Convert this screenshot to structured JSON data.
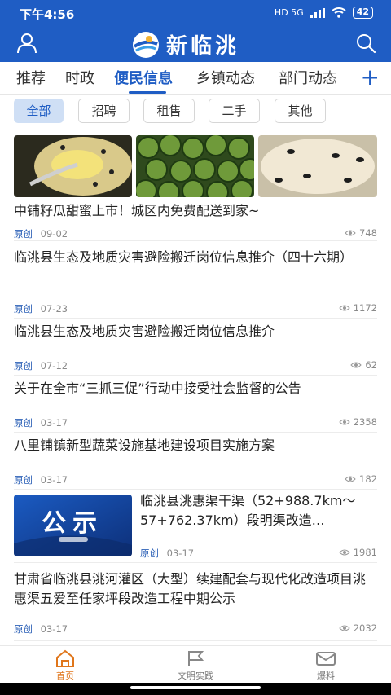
{
  "status_bar": {
    "time": "下午4:56",
    "network": "HD 5G",
    "battery": "42"
  },
  "header": {
    "logo_text": "新临洮"
  },
  "channel_tabs": [
    {
      "label": "推荐",
      "active": false
    },
    {
      "label": "时政",
      "active": false
    },
    {
      "label": "便民信息",
      "active": true
    },
    {
      "label": "乡镇动态",
      "active": false
    },
    {
      "label": "部门动态",
      "active": false
    }
  ],
  "filters": [
    {
      "label": "全部",
      "active": true
    },
    {
      "label": "招聘",
      "active": false
    },
    {
      "label": "租售",
      "active": false
    },
    {
      "label": "二手",
      "active": false
    },
    {
      "label": "其他",
      "active": false
    }
  ],
  "articles": [
    {
      "title": "中铺籽瓜甜蜜上市！城区内免费配送到家~",
      "source": "原创",
      "date": "09-02",
      "views": "748",
      "layout": "three-images"
    },
    {
      "title": "临洮县生态及地质灾害避险搬迁岗位信息推介（四十六期）",
      "source": "原创",
      "date": "07-23",
      "views": "1172",
      "layout": "text"
    },
    {
      "title": "临洮县生态及地质灾害避险搬迁岗位信息推介",
      "source": "原创",
      "date": "07-12",
      "views": "62",
      "layout": "text"
    },
    {
      "title": "关于在全市“三抓三促”行动中接受社会监督的公告",
      "source": "原创",
      "date": "03-17",
      "views": "2358",
      "layout": "text"
    },
    {
      "title": "八里铺镇新型蔬菜设施基地建设项目实施方案",
      "source": "原创",
      "date": "03-17",
      "views": "182",
      "layout": "text"
    },
    {
      "title": "临洮县洮惠渠干渠（52+988.7km～57+762.37km）段明渠改造…",
      "source": "原创",
      "date": "03-17",
      "views": "1981",
      "layout": "thumb",
      "thumb_text": "公示"
    },
    {
      "title": "甘肃省临洮县洮河灌区（大型）续建配套与现代化改造项目洮惠渠五爱至任家坪段改造工程中期公示",
      "source": "原创",
      "date": "03-17",
      "views": "2032",
      "layout": "text"
    }
  ],
  "bottom_nav": [
    {
      "label": "首页",
      "icon": "home-icon",
      "active": true
    },
    {
      "label": "文明实践",
      "icon": "flag-icon",
      "active": false
    },
    {
      "label": "爆料",
      "icon": "mail-icon",
      "active": false
    }
  ],
  "colors": {
    "brand_blue": "#1f5dc4",
    "active_nav": "#e0761b",
    "chip_active_bg": "#cfdff5"
  }
}
